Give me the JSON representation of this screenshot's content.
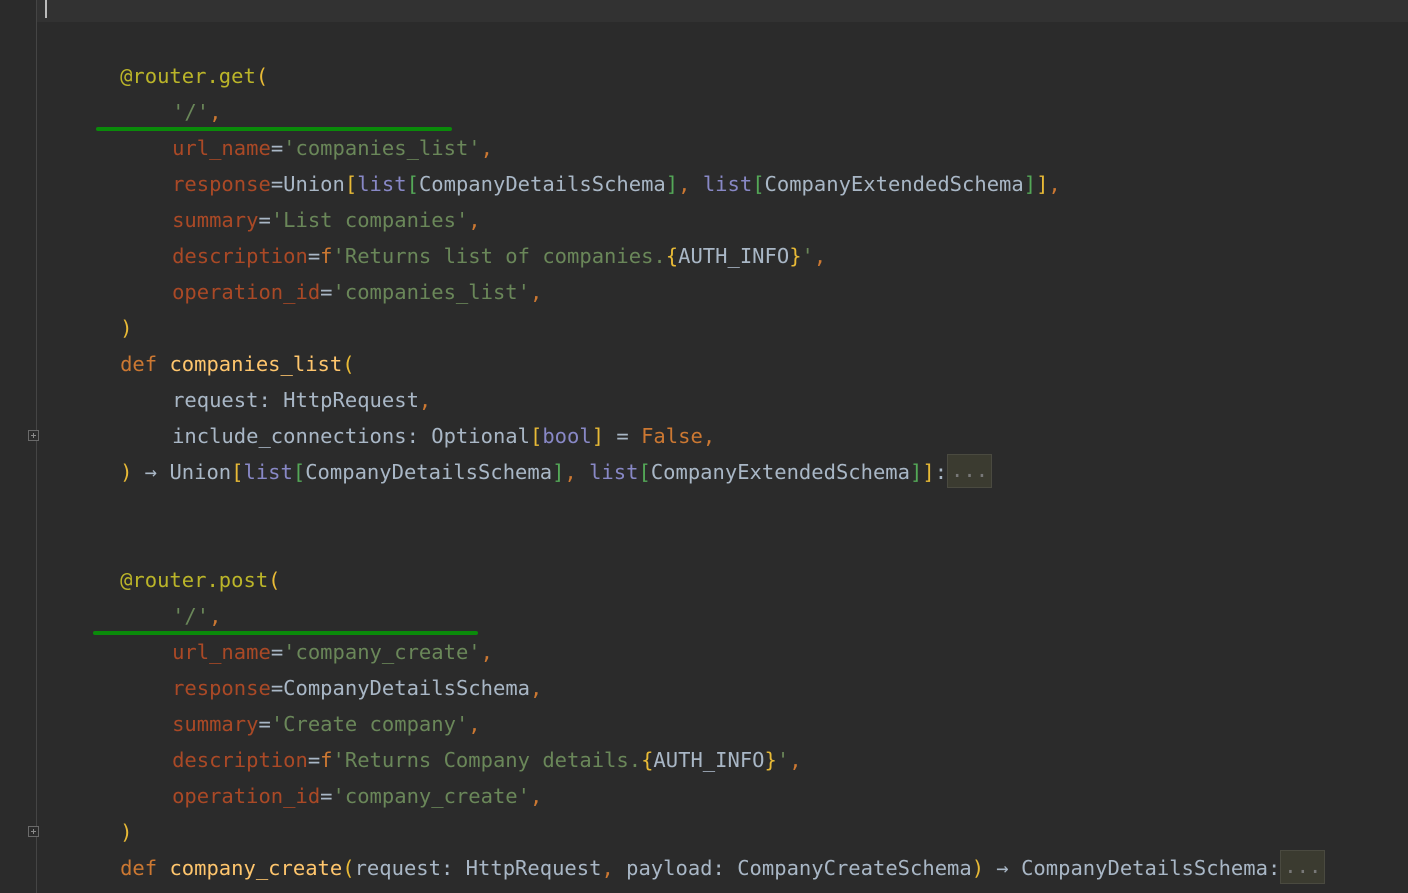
{
  "editor": {
    "line1": {
      "deco": "@router.get",
      "open": "("
    },
    "line2": {
      "str": "'/'",
      "comma": ","
    },
    "line3": {
      "param": "url_name",
      "eq": "=",
      "str": "'companies_list'",
      "comma": ","
    },
    "line4": {
      "param": "response",
      "eq": "=",
      "t1": "Union",
      "b1": "[",
      "bi1": "list",
      "b2": "[",
      "t2": "CompanyDetailsSchema",
      "b3": "]",
      "c1": ",",
      "sp": " ",
      "bi2": "list",
      "b4": "[",
      "t3": "CompanyExtendedSchema",
      "b5": "]",
      "b6": "]",
      "comma": ","
    },
    "line5": {
      "param": "summary",
      "eq": "=",
      "str": "'List companies'",
      "comma": ","
    },
    "line6": {
      "param": "description",
      "eq": "=",
      "f": "f",
      "str1": "'Returns list of companies.",
      "b1": "{",
      "expr": "AUTH_INFO",
      "b2": "}",
      "str2": "'",
      "comma": ","
    },
    "line7": {
      "param": "operation_id",
      "eq": "=",
      "str": "'companies_list'",
      "comma": ","
    },
    "line8": {
      "close": ")"
    },
    "line9": {
      "kw": "def",
      "fn": "companies_list",
      "open": "("
    },
    "line10": {
      "name": "request",
      "colon": ": ",
      "type": "HttpRequest",
      "comma": ","
    },
    "line11": {
      "name": "include_connections",
      "colon": ": ",
      "type": "Optional",
      "b1": "[",
      "bi": "bool",
      "b2": "]",
      "eq": " = ",
      "val": "False",
      "comma": ","
    },
    "line12": {
      "close": ")",
      "arrow": " → ",
      "t1": "Union",
      "b1": "[",
      "bi1": "list",
      "b2": "[",
      "t2": "CompanyDetailsSchema",
      "b3": "]",
      "c1": ",",
      "sp": " ",
      "bi2": "list",
      "b4": "[",
      "t3": "CompanyExtendedSchema",
      "b5": "]",
      "b6": "]",
      "colon": ":",
      "fold": "..."
    },
    "line13": {
      "deco": "@router.post",
      "open": "("
    },
    "line14": {
      "str": "'/'",
      "comma": ","
    },
    "line15": {
      "param": "url_name",
      "eq": "=",
      "str": "'company_create'",
      "comma": ","
    },
    "line16": {
      "param": "response",
      "eq": "=",
      "type": "CompanyDetailsSchema",
      "comma": ","
    },
    "line17": {
      "param": "summary",
      "eq": "=",
      "str": "'Create company'",
      "comma": ","
    },
    "line18": {
      "param": "description",
      "eq": "=",
      "f": "f",
      "str1": "'Returns Company details.",
      "b1": "{",
      "expr": "AUTH_INFO",
      "b2": "}",
      "str2": "'",
      "comma": ","
    },
    "line19": {
      "param": "operation_id",
      "eq": "=",
      "str": "'company_create'",
      "comma": ","
    },
    "line20": {
      "close": ")"
    },
    "line21": {
      "kw": "def",
      "fn": "company_create",
      "open": "(",
      "p1": "request",
      "colon1": ": ",
      "t1": "HttpRequest",
      "c1": ",",
      "sp": " ",
      "p2": "payload",
      "colon2": ": ",
      "t2": "CompanyCreateSchema",
      "close": ")",
      "arrow": " → ",
      "t3": "CompanyDetailsSchema",
      "colon": ":",
      "fold": "..."
    }
  },
  "colors": {
    "background": "#2b2b2b",
    "underline": "#0a8a0a"
  }
}
